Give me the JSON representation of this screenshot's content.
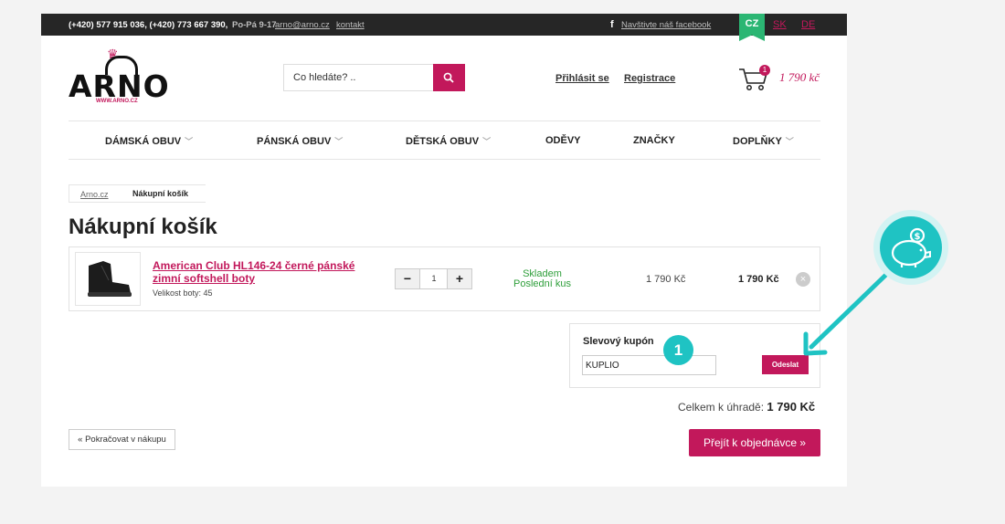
{
  "topbar": {
    "phones": "(+420) 577 915 036, (+420) 773 667 390,",
    "hours": "Po-Pá 9-17",
    "email": "arno@arno.cz",
    "contact_link": "kontakt",
    "facebook_icon_text": "f",
    "facebook_link": "Navštivte náš facebook",
    "languages": [
      "CZ",
      "SK",
      "DE"
    ],
    "active_language": "CZ"
  },
  "logo": {
    "word": "ARNO",
    "url": "WWW.ARNO.CZ"
  },
  "search": {
    "placeholder": "Co hledáte? .."
  },
  "header": {
    "login": "Přihlásit se",
    "register": "Registrace",
    "cart_count": "1",
    "cart_total": "1 790 kč"
  },
  "nav": {
    "items": [
      {
        "label": "DÁMSKÁ OBUV",
        "has_dropdown": true
      },
      {
        "label": "PÁNSKÁ OBUV",
        "has_dropdown": true
      },
      {
        "label": "DĚTSKÁ OBUV",
        "has_dropdown": true
      },
      {
        "label": "ODĚVY",
        "has_dropdown": false
      },
      {
        "label": "ZNAČKY",
        "has_dropdown": false
      },
      {
        "label": "DOPLŇKY",
        "has_dropdown": true
      }
    ]
  },
  "breadcrumb": {
    "home": "Arno.cz",
    "current": "Nákupní košík"
  },
  "page_title": "Nákupní košík",
  "cart_item": {
    "name": "American Club HL146-24 černé pánské zimní softshell boty",
    "size": "Velikost boty: 45",
    "qty_minus": "−",
    "qty": "1",
    "qty_plus": "+",
    "stock_line1": "Skladem",
    "stock_line2": "Poslední kus",
    "unit_price": "1 790 Kč",
    "total": "1 790 Kč",
    "remove": "×"
  },
  "coupon": {
    "title": "Slevový kupón",
    "value": "KUPLIO",
    "submit": "Odeslat"
  },
  "summary": {
    "total_label": "Celkem k úhradě:",
    "total_value": "1 790 Kč"
  },
  "actions": {
    "continue": "« Pokračovat v nákupu",
    "checkout": "Přejít k objednávce  »"
  },
  "annotation": {
    "step_number": "1",
    "accent_color": "#1fc3c3"
  },
  "colors": {
    "brand": "#c2185b",
    "topbar": "#262626",
    "active_lang": "#2bb673",
    "stock": "#2e9e3a"
  }
}
